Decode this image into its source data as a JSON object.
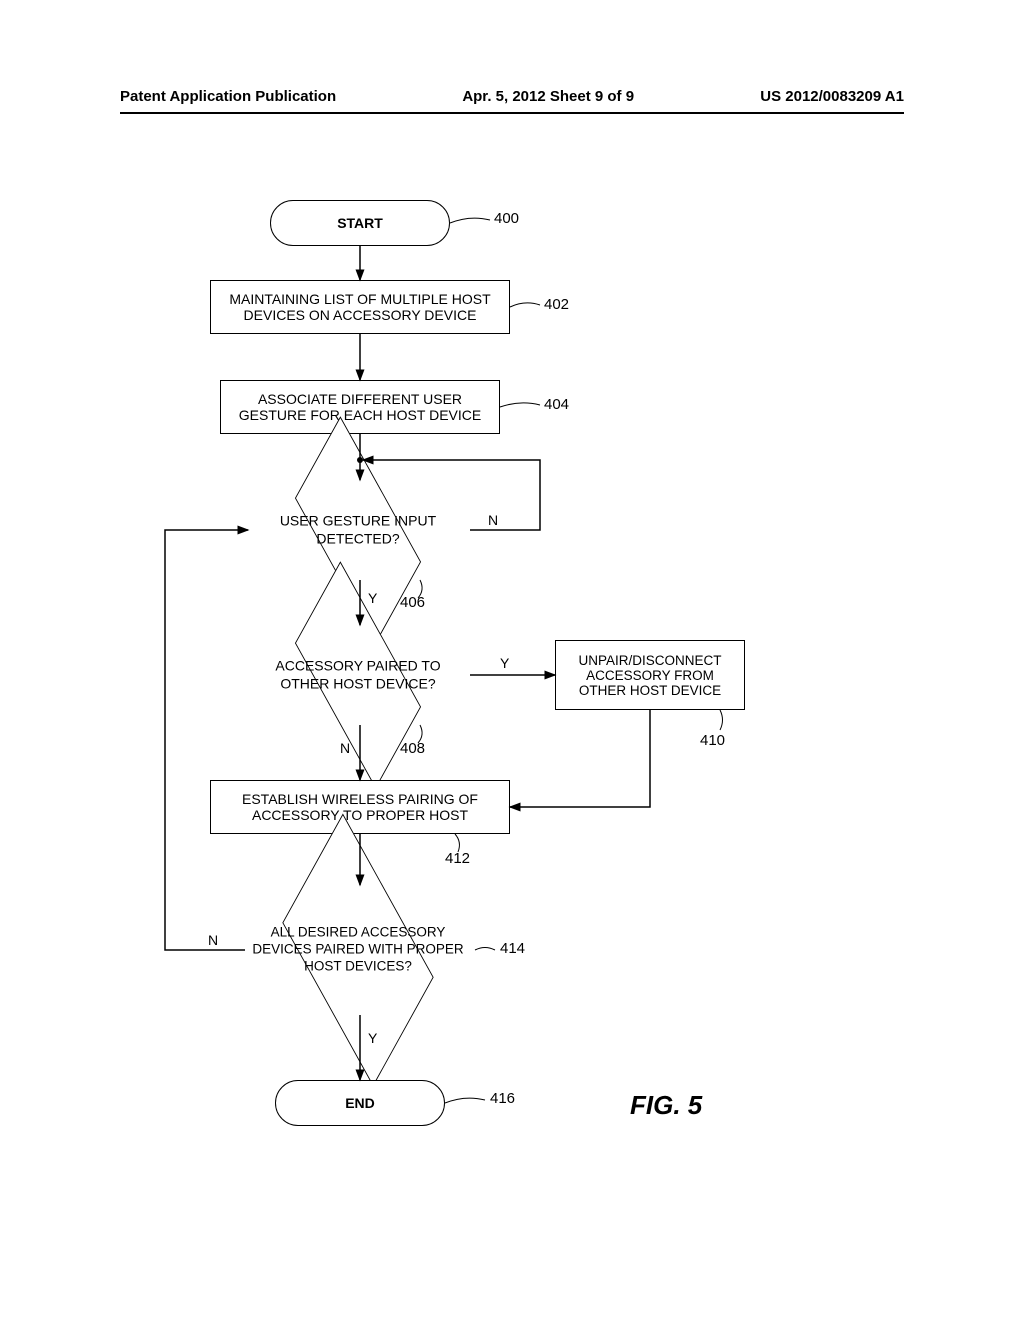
{
  "header": {
    "left": "Patent Application Publication",
    "center": "Apr. 5, 2012  Sheet 9 of 9",
    "right": "US 2012/0083209 A1"
  },
  "flow": {
    "start": "START",
    "end": "END",
    "box1": "MAINTAINING LIST OF MULTIPLE HOST DEVICES ON ACCESSORY DEVICE",
    "box2": "ASSOCIATE DIFFERENT USER GESTURE FOR EACH HOST DEVICE",
    "dec1": "USER GESTURE INPUT DETECTED?",
    "dec2": "ACCESSORY PAIRED TO OTHER HOST DEVICE?",
    "box3": "UNPAIR/DISCONNECT ACCESSORY FROM OTHER HOST DEVICE",
    "box4": "ESTABLISH WIRELESS PAIRING OF ACCESSORY TO PROPER  HOST",
    "dec3": "ALL DESIRED ACCESSORY DEVICES PAIRED WITH PROPER HOST DEVICES?",
    "ref": {
      "r400": "400",
      "r402": "402",
      "r404": "404",
      "r406": "406",
      "r408": "408",
      "r410": "410",
      "r412": "412",
      "r414": "414",
      "r416": "416"
    },
    "yes": "Y",
    "no": "N",
    "figcap": "FIG. 5"
  }
}
